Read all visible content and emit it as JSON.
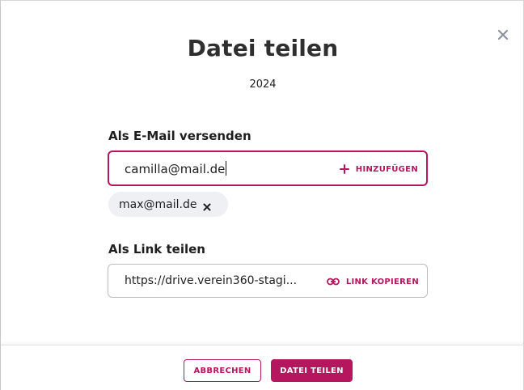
{
  "dialog": {
    "title": "Datei teilen",
    "subtitle": "2024",
    "close_icon": "close-icon"
  },
  "email_section": {
    "label": "Als E-Mail versenden",
    "input_value": "camilla@mail.de",
    "add_icon": "plus-icon",
    "add_label": "HINZUFÜGEN",
    "recipients": [
      {
        "email": "max@mail.de",
        "remove_icon": "close-icon"
      }
    ]
  },
  "link_section": {
    "label": "Als Link teilen",
    "link_value": "https://drive.verein360-stagi...",
    "copy_icon": "link-icon",
    "copy_label": "LINK KOPIEREN"
  },
  "footer": {
    "cancel_label": "ABBRECHEN",
    "submit_label": "DATEI TEILEN"
  },
  "colors": {
    "accent": "#b5165e",
    "chip_background": "#eef0f3",
    "text": "#1e1e1e",
    "close_icon": "#8a929c"
  }
}
